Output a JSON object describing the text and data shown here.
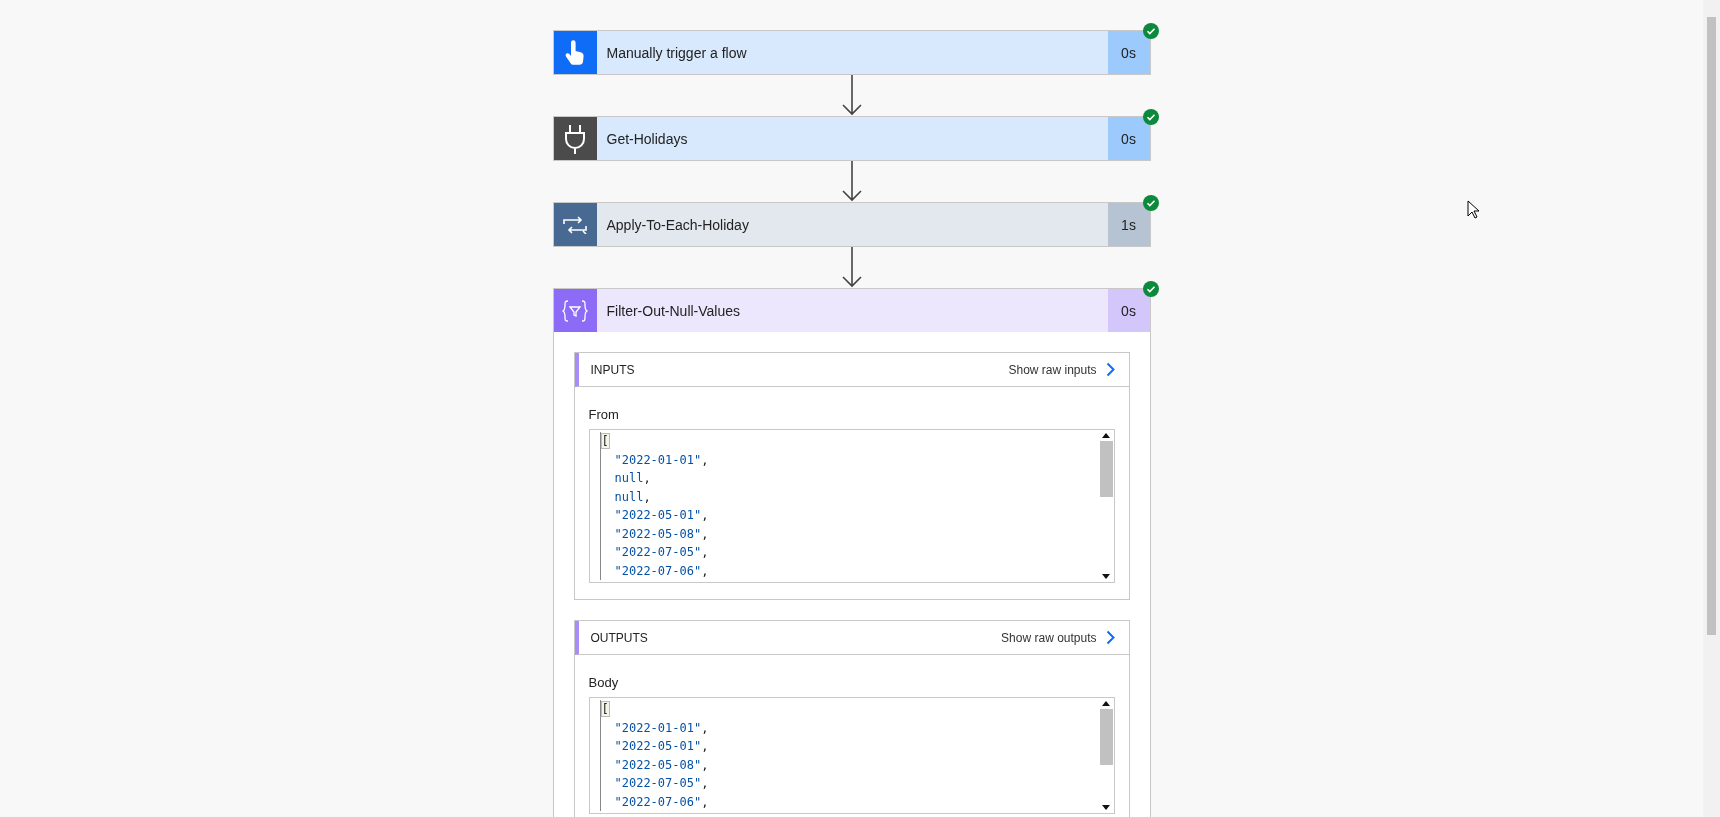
{
  "steps": [
    {
      "kind": "trigger",
      "title": "Manually trigger a flow",
      "duration": "0s",
      "succeeded": true,
      "expanded": false
    },
    {
      "kind": "connector",
      "title": "Get-Holidays",
      "duration": "0s",
      "succeeded": true,
      "expanded": false
    },
    {
      "kind": "loop",
      "title": "Apply-To-Each-Holiday",
      "duration": "1s",
      "succeeded": true,
      "expanded": false
    },
    {
      "kind": "filter",
      "title": "Filter-Out-Null-Values",
      "duration": "0s",
      "succeeded": true,
      "expanded": true,
      "sections": [
        {
          "heading": "INPUTS",
          "link": "Show raw inputs",
          "field_label": "From",
          "lines": [
            "[",
            "\"2022-01-01\",",
            "null,",
            "null,",
            "\"2022-05-01\",",
            "\"2022-05-08\",",
            "\"2022-07-05\",",
            "\"2022-07-06\","
          ]
        },
        {
          "heading": "OUTPUTS",
          "link": "Show raw outputs",
          "field_label": "Body",
          "lines": [
            "[",
            "\"2022-01-01\",",
            "\"2022-05-01\",",
            "\"2022-05-08\",",
            "\"2022-07-05\",",
            "\"2022-07-06\","
          ]
        }
      ]
    }
  ]
}
